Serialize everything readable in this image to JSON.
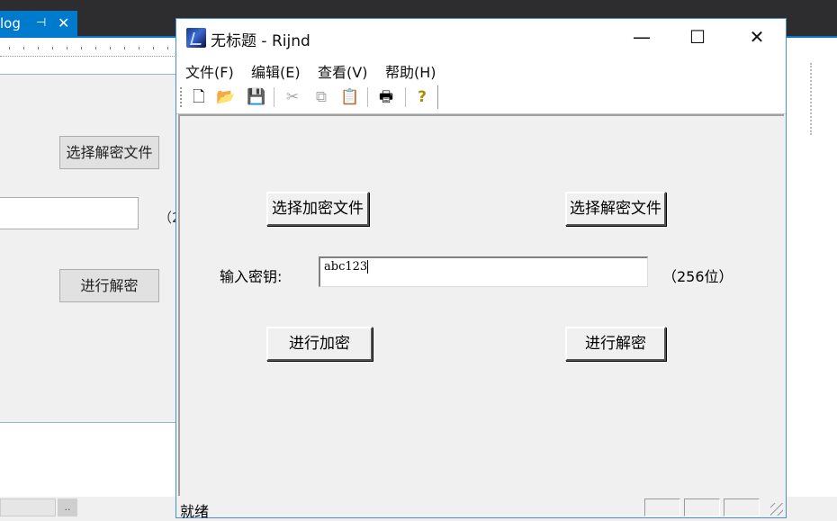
{
  "background_ide": {
    "tab_label": "log",
    "pin_glyph": "⊣",
    "close_glyph": "✕",
    "select_decrypt_label": "选择解密文件",
    "key_hint_partial": "（2",
    "decrypt_label": "进行解密",
    "bottom_button": ".."
  },
  "window": {
    "title": "无标题 - Rijnd",
    "controls": {
      "minimize": "—",
      "maximize": "☐",
      "close": "✕"
    },
    "menu": [
      {
        "label": "文件(F)"
      },
      {
        "label": "编辑(E)"
      },
      {
        "label": "查看(V)"
      },
      {
        "label": "帮助(H)"
      }
    ],
    "toolbar": [
      {
        "icon": "new-file-icon",
        "glyph": "🗋",
        "enabled": true
      },
      {
        "icon": "open-folder-icon",
        "glyph": "📂",
        "enabled": true
      },
      {
        "icon": "save-icon",
        "glyph": "💾",
        "enabled": true
      },
      {
        "icon": "cut-icon",
        "glyph": "✂",
        "enabled": false
      },
      {
        "icon": "copy-icon",
        "glyph": "⧉",
        "enabled": false
      },
      {
        "icon": "paste-icon",
        "glyph": "📋",
        "enabled": false
      },
      {
        "icon": "print-icon",
        "glyph": "🖶",
        "enabled": true
      },
      {
        "icon": "help-icon",
        "glyph": "?",
        "enabled": true
      }
    ],
    "form": {
      "select_encrypt_label": "选择加密文件",
      "select_decrypt_label": "选择解密文件",
      "key_label": "输入密钥:",
      "key_value": "abc123",
      "key_hint": "（256位）",
      "encrypt_label": "进行加密",
      "decrypt_label": "进行解密"
    },
    "status_text": "就绪"
  }
}
